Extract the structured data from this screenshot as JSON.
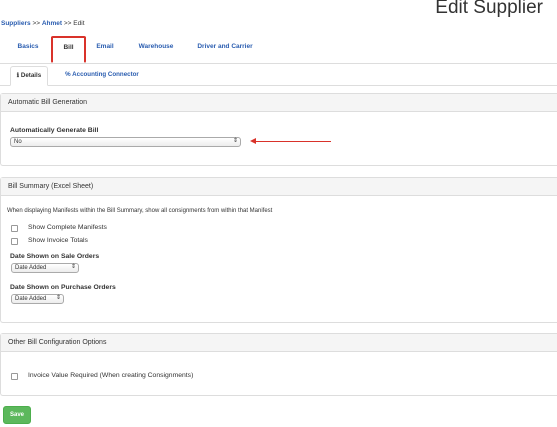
{
  "breadcrumb": {
    "root": "Suppliers",
    "sep1": ">>",
    "entity": "Ahmet",
    "sep2": ">>",
    "current": "Edit"
  },
  "page_title": "Edit Supplier",
  "main_tabs": [
    {
      "label": "Basics"
    },
    {
      "label": "Bill"
    },
    {
      "label": "Email"
    },
    {
      "label": "Warehouse"
    },
    {
      "label": "Driver and Carrier"
    }
  ],
  "sub_tabs": [
    {
      "label": "Details",
      "icon": "info-icon"
    },
    {
      "label": "Accounting Connector",
      "icon": "link-icon"
    }
  ],
  "auto_bill": {
    "heading": "Automatic Bill Generation",
    "field_label": "Automatically Generate Bill",
    "selected": "No"
  },
  "bill_summary": {
    "heading": "Bill Summary (Excel Sheet)",
    "description": "When displaying Manifests within the Bill Summary, show all consignments from within that Manifest",
    "checkboxes": [
      {
        "label": "Show Complete Manifests",
        "checked": false
      },
      {
        "label": "Show Invoice Totals",
        "checked": false
      }
    ],
    "sale_orders_label": "Date Shown on Sale Orders",
    "sale_orders_value": "Date Added",
    "purchase_orders_label": "Date Shown on Purchase Orders",
    "purchase_orders_value": "Date Added"
  },
  "other_options": {
    "heading": "Other Bill Configuration Options",
    "checkbox_label": "Invoice Value Required (When creating Consignments)",
    "checked": false
  },
  "save_label": "Save",
  "colors": {
    "link": "#2a5db0",
    "highlight": "#d9322a",
    "save": "#5cb85c"
  }
}
